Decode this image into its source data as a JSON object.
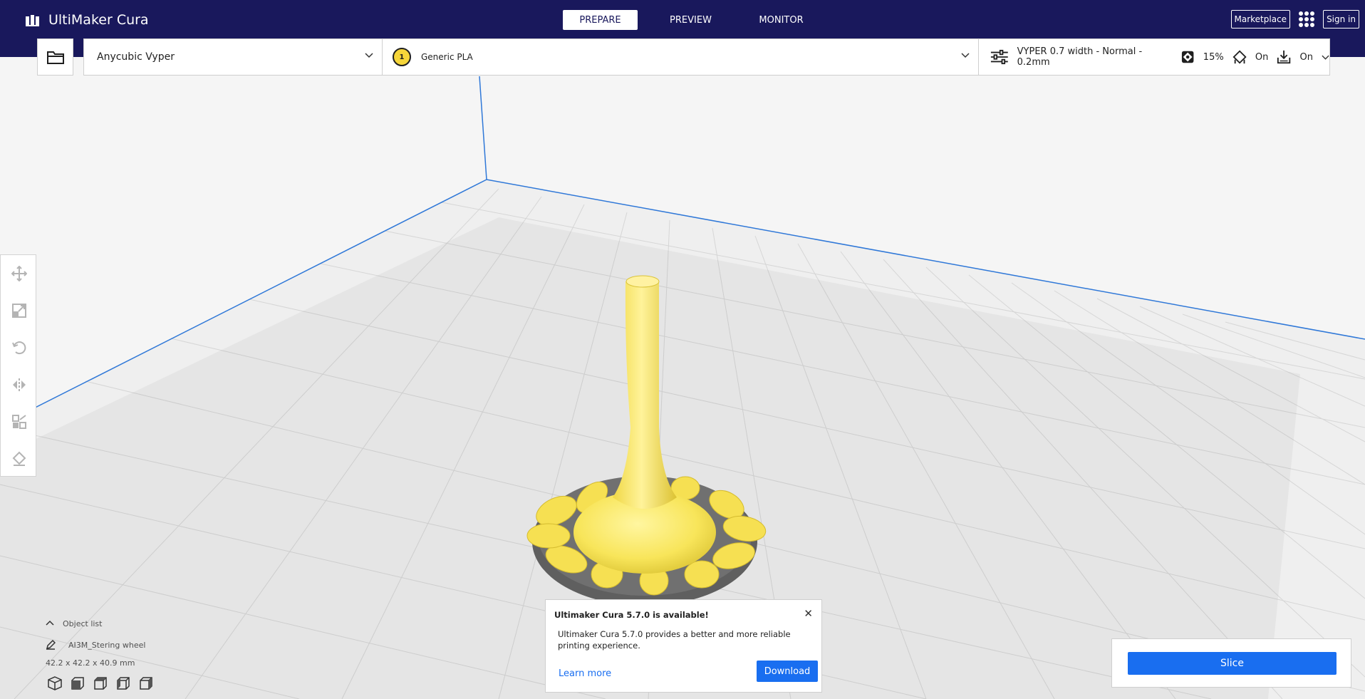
{
  "app": {
    "title": "UltiMaker Cura"
  },
  "stages": [
    "PREPARE",
    "PREVIEW",
    "MONITOR"
  ],
  "header": {
    "marketplace": "Marketplace",
    "sign_in": "Sign in"
  },
  "printer": {
    "name": "Anycubic Vyper"
  },
  "material": {
    "extruder": "1",
    "name": "Generic PLA"
  },
  "print_settings": {
    "profile": "VYPER 0.7 width - Normal - 0.2mm",
    "infill": "15%",
    "support": "On",
    "adhesion": "On"
  },
  "objects": {
    "header": "Object list",
    "name": "AI3M_Stering wheel",
    "dimensions": "42.2 x 42.2 x 40.9 mm"
  },
  "notification": {
    "title": "Ultimaker Cura 5.7.0 is available!",
    "body": "Ultimaker Cura 5.7.0 provides a better and more reliable printing experience.",
    "learn_more": "Learn more",
    "download": "Download"
  },
  "slice": {
    "label": "Slice"
  },
  "colors": {
    "header_bg": "#19185c",
    "accent": "#196ef0",
    "model": "#f8e55a",
    "raft": "#6b6b6b"
  }
}
